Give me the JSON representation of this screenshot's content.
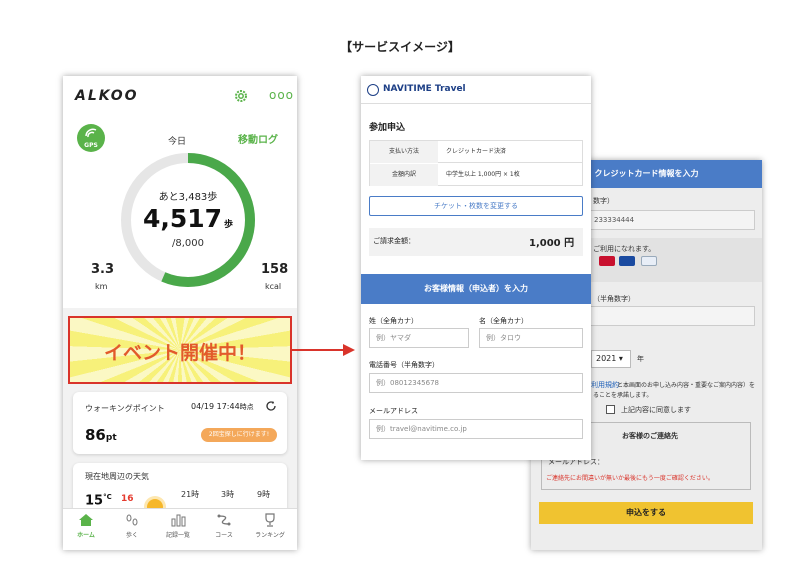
{
  "page_title": "【サービスイメージ】",
  "alkoo": {
    "logo": "ALKOO",
    "gps_label": "GPS",
    "today_label": "今日",
    "move_log_label": "移動ログ",
    "steps_remaining": "あと3,483歩",
    "steps_value": "4,517",
    "steps_unit": "歩",
    "steps_goal": "/8,000",
    "steps_progress": 0.565,
    "distance_value": "3.3",
    "distance_unit": "km",
    "calories_value": "158",
    "calories_unit": "kcal",
    "event_banner": "イベント開催中！",
    "walking_point_label": "ウォーキングポイント",
    "walking_point_date": "04/19 17:44",
    "walking_point_date_suffix": "時点",
    "points_value": "86",
    "points_unit": "pt",
    "points_pill": "2回宝探しに行けます!",
    "weather_label": "現在地周辺の天気",
    "temp_value": "15",
    "temp_unit": "°C",
    "temp_high": "16",
    "hours": [
      "21時",
      "3時",
      "9時"
    ],
    "tabs": [
      {
        "label": "ホーム",
        "icon": "home-icon",
        "active": true
      },
      {
        "label": "歩く",
        "icon": "footprints-icon",
        "active": false
      },
      {
        "label": "記録一覧",
        "icon": "chart-icon",
        "active": false
      },
      {
        "label": "コース",
        "icon": "route-icon",
        "active": false
      },
      {
        "label": "ランキング",
        "icon": "trophy-icon",
        "active": false
      }
    ],
    "accent_color": "#5ab34a"
  },
  "navitime": {
    "brand": "NAVITIME Travel",
    "section_title": "参加申込",
    "payment_method_label": "支払い方法",
    "payment_method_value": "クレジットカード決済",
    "amount_label": "金額内訳",
    "amount_value": "中学生以上 1,000円 × 1枚",
    "change_ticket_button": "チケット・枚数を変更する",
    "total_label": "ご請求金額：",
    "total_value": "1,000 円",
    "customer_info_header": "お客様情報（申込者）を入力",
    "last_name_label": "姓（全角カナ）",
    "last_name_placeholder": "例）ヤマダ",
    "first_name_label": "名（全角カナ）",
    "first_name_placeholder": "例）タロウ",
    "phone_label": "電話番号（半角数字）",
    "phone_placeholder": "例）08012345678",
    "email_label": "メールアドレス",
    "email_placeholder": "例）travel@navitime.co.jp",
    "accent_color": "#4a7cc7"
  },
  "credit": {
    "header": "クレジットカード情報を入力",
    "card_number_suffix": "数字）",
    "card_number_value": "233334444",
    "usable_text": "ご利用になれます。",
    "security_label": "（半角数字）",
    "year_value": "2021",
    "year_unit": "年",
    "terms_text_1": "利用規約",
    "terms_text_2": "と本画面のお申し込み内容・重要なご案内内容）を",
    "terms_text_3": "ることを承諾します。",
    "agree_label": "上記内容に同意します",
    "contact_title": "お客様のご連絡先",
    "email_label": "メールアドレス：",
    "warning": "ご連絡先にお間違いが無いか最後にもう一度ご確認ください。",
    "apply_button": "申込をする"
  }
}
